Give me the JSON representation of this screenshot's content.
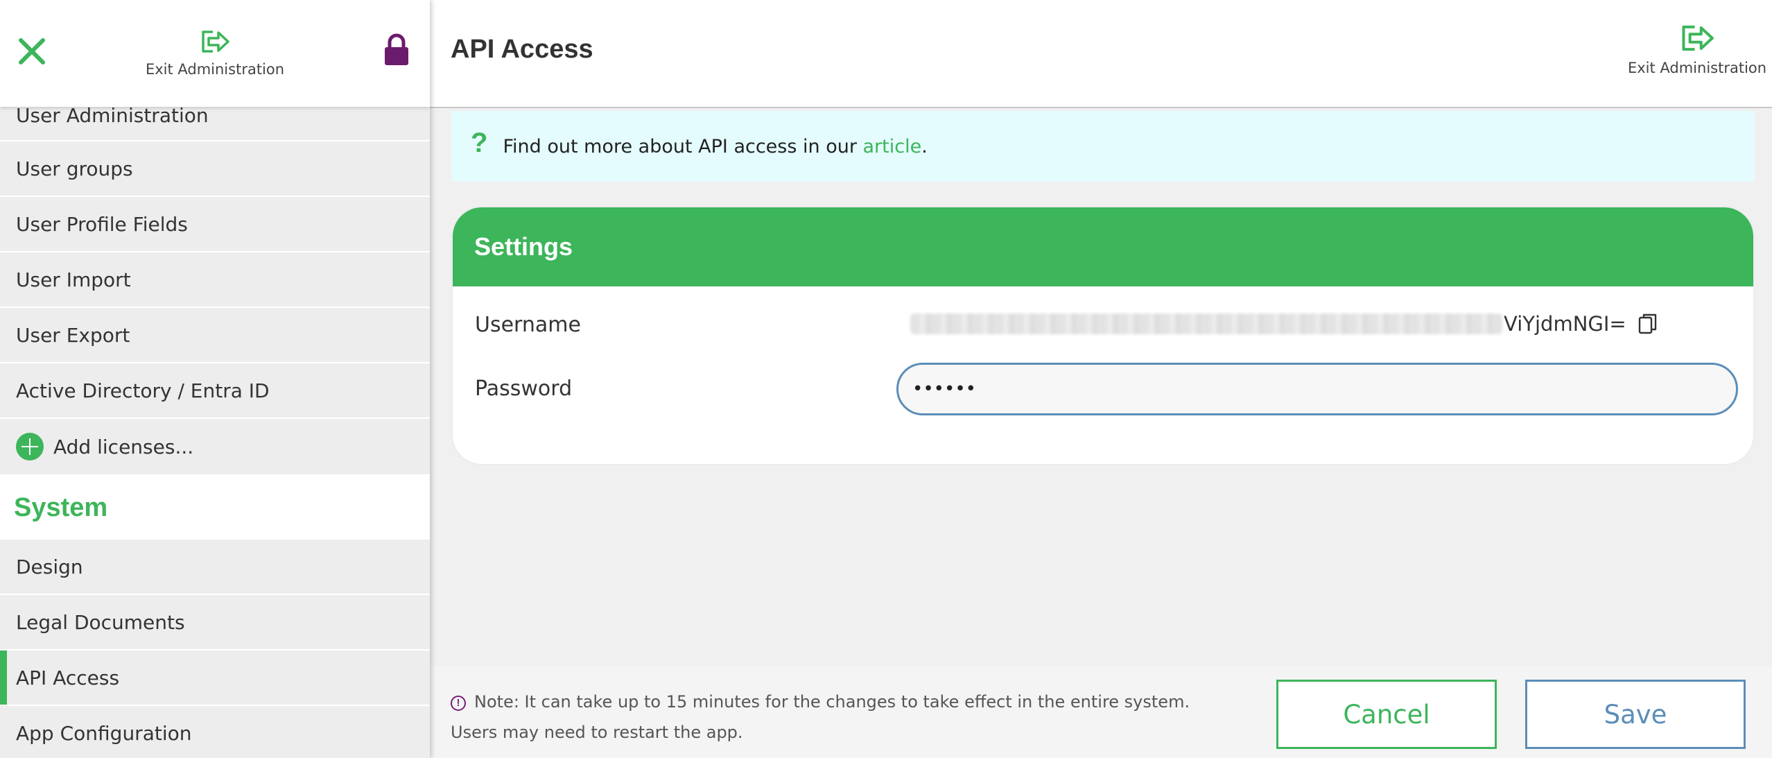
{
  "sidebar": {
    "exit_label": "Exit Administration",
    "items": [
      {
        "label": "User Administration"
      },
      {
        "label": "User groups"
      },
      {
        "label": "User Profile Fields"
      },
      {
        "label": "User Import"
      },
      {
        "label": "User Export"
      },
      {
        "label": "Active Directory / Entra ID"
      }
    ],
    "add_licenses_label": "Add licenses...",
    "section_system": "System",
    "system_items": [
      {
        "label": "Design"
      },
      {
        "label": "Legal Documents"
      },
      {
        "label": "API Access",
        "active": true
      },
      {
        "label": "App Configuration"
      }
    ]
  },
  "header": {
    "title": "API Access",
    "exit_label": "Exit Administration"
  },
  "info": {
    "text_before": "Find out more about API access in our ",
    "link_text": "article",
    "text_after": "."
  },
  "settings": {
    "title": "Settings",
    "username_label": "Username",
    "username_suffix": "ViYjdmNGI=",
    "password_label": "Password",
    "password_value": "••••••"
  },
  "footer": {
    "note": "Note: It can take up to 15 minutes for the changes to take effect in the entire system. Users may need to restart the app.",
    "cancel_label": "Cancel",
    "save_label": "Save"
  },
  "colors": {
    "accent_green": "#3db55a",
    "accent_blue": "#5b8db8",
    "lock_purple": "#6b1b6b",
    "info_bg": "#e4fcfd"
  },
  "icons": {
    "close": "close-icon",
    "exit": "exit-icon",
    "lock": "lock-icon",
    "question": "question-icon",
    "copy": "copy-icon",
    "plus": "plus-icon",
    "warning": "warning-icon"
  }
}
